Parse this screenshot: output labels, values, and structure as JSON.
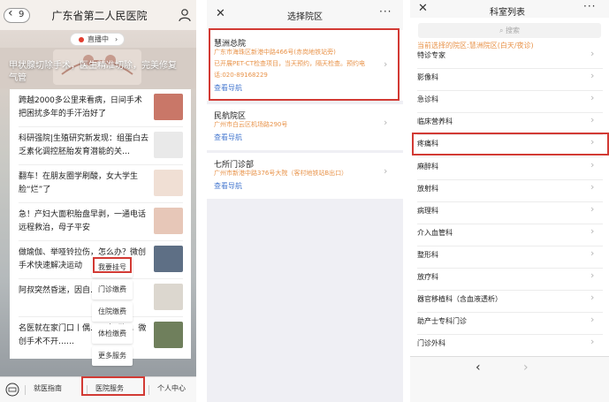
{
  "screen1": {
    "back_count": "9",
    "title": "广东省第二人民医院",
    "live_label": "直播中",
    "banner_text": "甲状腺切除手术，医生精准切除，完美修复气管",
    "articles": [
      {
        "title": "跨越2000多公里来看病，日间手术把困扰多年的手汗治好了"
      },
      {
        "title": "科研强院|生殖研究新发现：组蛋白去乏素化调控胚胎发育潜能的关…"
      },
      {
        "title": "翻车！在朋友圈学刷酸，女大学生脸“烂”了"
      },
      {
        "title": "急！产妇大面积胎盘早剥，一通电话远程救治，母子平安"
      },
      {
        "title": "做瑜伽、举哑铃拉伤，怎么办？微创手术快速解决运动"
      },
      {
        "title": "阿叔突然昏迷，因自……加药"
      },
      {
        "title": "名医就在家门口丨偶……个“孔”，微创手术不开……"
      }
    ],
    "menu_items": [
      "我要挂号",
      "门诊缴费",
      "住院缴费",
      "体检缴费",
      "更多服务"
    ],
    "tabs": [
      "就医指南",
      "医院服务",
      "个人中心"
    ]
  },
  "screen2": {
    "title": "选择院区",
    "hospitals": [
      {
        "name": "慧洲总院",
        "address": "广东市海珠区新港中路466号(赤岗地铁站旁)",
        "note": "已开展PET-CT检查项目，当天预约，隔天检查。预约电话:020-89168229",
        "nav_label": "查看导航"
      },
      {
        "name": "民航院区",
        "address": "广州市白云区机场路290号",
        "note": "",
        "nav_label": "查看导航"
      },
      {
        "name": "七所门诊部",
        "address": "广州市新港中路376号大院（客村地铁站B出口）",
        "note": "",
        "nav_label": "查看导航"
      }
    ]
  },
  "screen3": {
    "title": "科室列表",
    "search_placeholder": "搜索",
    "current_campus": "当前选择的院区:慧洲院区(白天/夜诊)",
    "departments": [
      "特诊专家",
      "影像科",
      "急诊科",
      "临床营养科",
      "疼痛科",
      "麻醉科",
      "放射科",
      "病理科",
      "介入血管科",
      "整形科",
      "放疗科",
      "器官移植科（含血液透析）",
      "助产士专科门诊",
      "门诊外科"
    ],
    "highlighted_department": "疼痛科"
  },
  "colors": {
    "highlight_red": "#d23a34",
    "orange_text": "#e8934a",
    "link_blue": "#4a7bd0",
    "live_red": "#e23d2f"
  }
}
